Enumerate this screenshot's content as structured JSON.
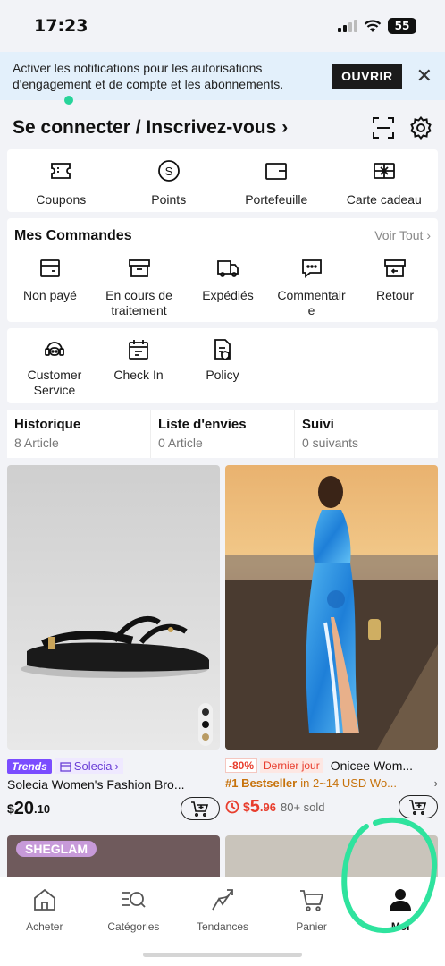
{
  "status": {
    "time": "17:23",
    "battery": "55"
  },
  "notification": {
    "text": "Activer les notifications pour les autorisations d'engagement et de compte et les abonnements.",
    "button": "OUVRIR"
  },
  "header": {
    "login_text": "Se connecter / Inscrivez-vous",
    "chevron": "›"
  },
  "wallet": [
    {
      "label": "Coupons",
      "icon": "coupon-icon"
    },
    {
      "label": "Points",
      "icon": "points-icon"
    },
    {
      "label": "Portefeuille",
      "icon": "wallet-icon"
    },
    {
      "label": "Carte cadeau",
      "icon": "gift-card-icon"
    }
  ],
  "orders": {
    "title": "Mes Commandes",
    "view_all": "Voir Tout",
    "items": [
      {
        "label": "Non payé",
        "icon": "unpaid-icon"
      },
      {
        "label": "En cours de traitement",
        "icon": "processing-icon"
      },
      {
        "label": "Expédiés",
        "icon": "shipped-icon"
      },
      {
        "label": "Commentaire",
        "icon": "review-icon"
      },
      {
        "label": "Retour",
        "icon": "return-icon"
      }
    ]
  },
  "services": [
    {
      "label": "Customer Service",
      "icon": "customer-service-icon"
    },
    {
      "label": "Check In",
      "icon": "check-in-icon"
    },
    {
      "label": "Policy",
      "icon": "policy-icon"
    }
  ],
  "history": [
    {
      "title": "Historique",
      "sub": "8 Article"
    },
    {
      "title": "Liste d'envies",
      "sub": "0 Article"
    },
    {
      "title": "Suivi",
      "sub": "0 suivants"
    }
  ],
  "products": [
    {
      "trend_label": "Trends",
      "store": "Solecia",
      "name": "Solecia Women's Fashion Bro...",
      "currency": "$",
      "price_main": "20",
      "price_cents": ".10"
    },
    {
      "discount": "-80%",
      "deal": "Dernier jour",
      "brand": "Onicee Wom...",
      "bestseller": "#1 Bestseller",
      "bestseller_in": "in 2~14 USD Wo...",
      "currency": "$",
      "price_main": "5",
      "price_cents": ".96",
      "sold": "80+ sold"
    }
  ],
  "peek": {
    "brand_badge": "SHEGLAM"
  },
  "tabs": [
    {
      "label": "Acheter",
      "icon": "home-icon"
    },
    {
      "label": "Catégories",
      "icon": "categories-icon"
    },
    {
      "label": "Tendances",
      "icon": "trends-icon"
    },
    {
      "label": "Panier",
      "icon": "cart-icon"
    },
    {
      "label": "Moi",
      "icon": "profile-icon"
    }
  ],
  "colors": {
    "accent_green": "#27d49a",
    "price_red": "#e83d2d",
    "trend_purple": "#7b4dff",
    "notif_bg": "#e3f0fb"
  }
}
